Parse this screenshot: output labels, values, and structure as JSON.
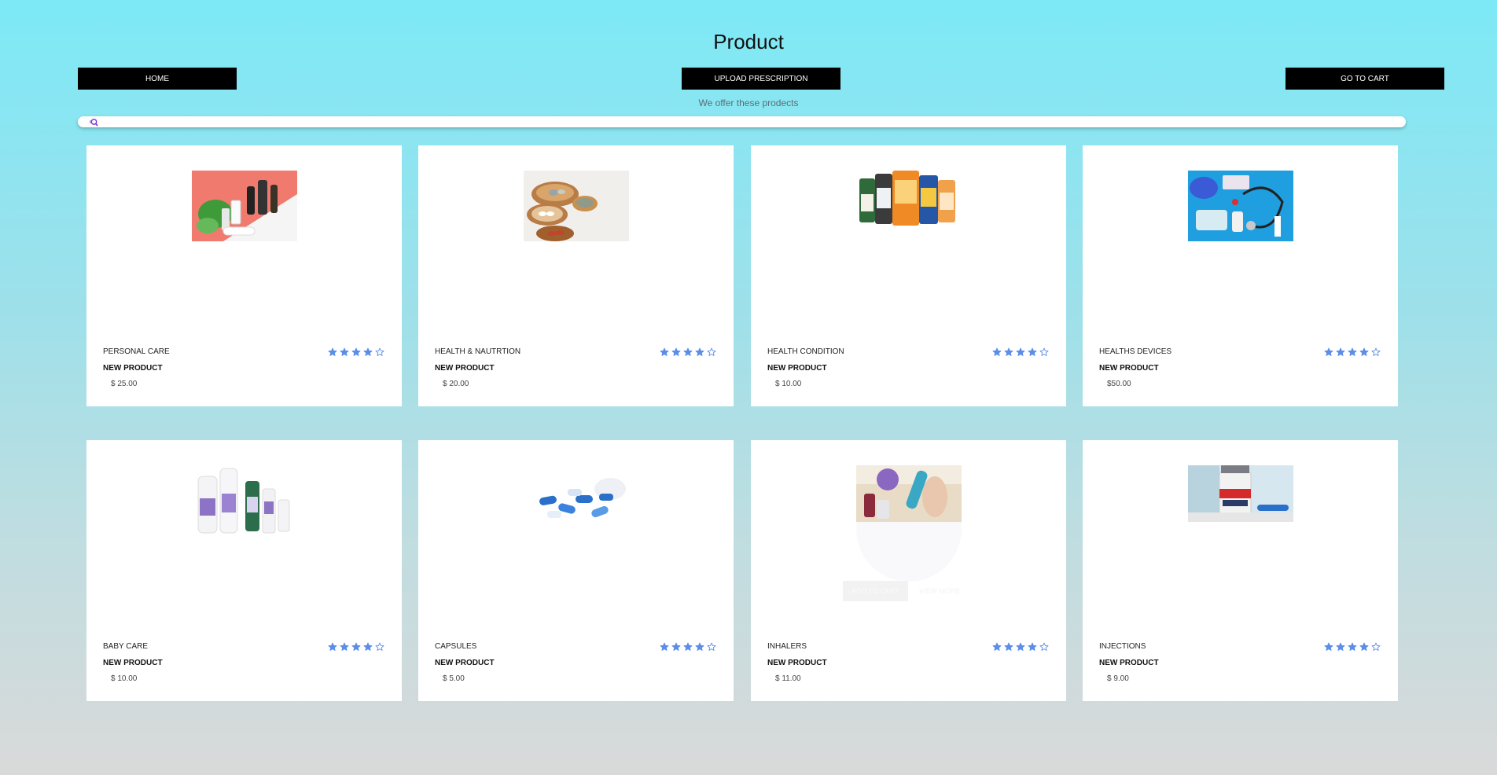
{
  "header": {
    "title": "Product",
    "subtitle": "We offer these prodects"
  },
  "nav": {
    "home": "HOME",
    "upload": "UPLOAD PRESCRIPTION",
    "cart": "GO TO CART"
  },
  "search": {
    "placeholder": ""
  },
  "badge_label": "NEW PRODUCT",
  "rating_filled": 4,
  "rating_max": 5,
  "colors": {
    "star": "#5b8ee8",
    "accent": "#000000"
  },
  "hover_overlay": {
    "add_to_cart": "ADD TO CART",
    "view_more": "VIEW MORE"
  },
  "products": [
    {
      "name": "PERSONAL CARE",
      "price": "$ 25.00",
      "image": "skincare-bottles"
    },
    {
      "name": "HEALTH & NAUTRTION",
      "price": "$ 20.00",
      "image": "supplement-bowls"
    },
    {
      "name": "HEALTH CONDITION",
      "price": "$ 10.00",
      "image": "vitamin-bottles"
    },
    {
      "name": "HEALTHS DEVICES",
      "price": "$50.00",
      "image": "medical-devices"
    },
    {
      "name": "BABY CARE",
      "price": "$ 10.00",
      "image": "baby-care-bottles"
    },
    {
      "name": "CAPSULES",
      "price": "$ 5.00",
      "image": "blue-capsules"
    },
    {
      "name": "INHALERS",
      "price": "$ 11.00",
      "image": "inhalers"
    },
    {
      "name": "INJECTIONS",
      "price": "$ 9.00",
      "image": "vaccine-vial"
    }
  ]
}
